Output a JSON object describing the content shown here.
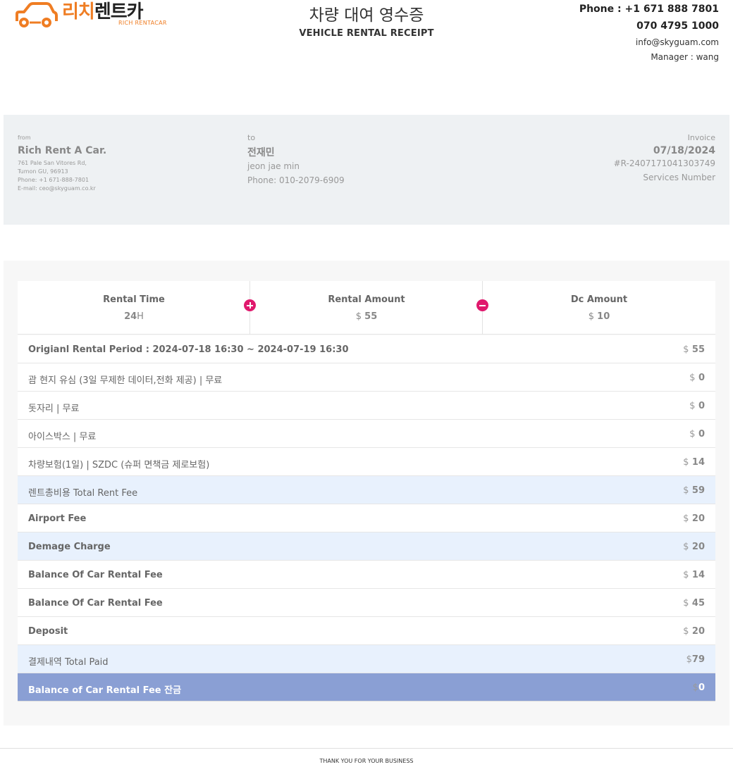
{
  "brand": {
    "name_ko_accent": "리치",
    "name_ko_rest": "렌트카",
    "name_en": "RICH RENTACAR",
    "accent_color": "#ef7d23"
  },
  "header": {
    "title": "차량 대여 영수증",
    "subtitle": "VEHICLE RENTAL RECEIPT"
  },
  "contact": {
    "phone1": "Phone : +1 671 888 7801",
    "phone2": "070 4795 1000",
    "email": "info@skyguam.com",
    "manager": "Manager : wang"
  },
  "from": {
    "label": "from",
    "name": "Rich Rent A Car.",
    "address1": "761 Pale San Vitores Rd,",
    "address2": "Tumon GU, 96913",
    "phone": "Phone: +1 671-888-7801",
    "email": "E-mail: ceo@skyguam.co.kr"
  },
  "to": {
    "label": "to",
    "name_ko": "전재민",
    "name_en": "jeon jae min",
    "phone": "Phone: 010-2079-6909"
  },
  "invoice": {
    "label": "Invoice",
    "date": "07/18/2024",
    "number": "#R-2407171041303749",
    "services": "Services Number"
  },
  "summary": {
    "rental_time": {
      "title": "Rental Time",
      "value": "24",
      "unit": "H"
    },
    "rental_amount": {
      "title": "Rental Amount",
      "currency": "$",
      "value": "55"
    },
    "dc_amount": {
      "title": "Dc Amount",
      "currency": "$",
      "value": "10"
    }
  },
  "rows": [
    {
      "label": "Origianl Rental Period : 2024-07-18 16:30 ~ 2024-07-19 16:30",
      "currency": "$",
      "amount": "55",
      "style": "plain",
      "bold": true
    },
    {
      "label": "괌 현지 유심 (3일 무제한 데이터,전화 제공) | 무료",
      "currency": "$",
      "amount": "0",
      "style": "plain",
      "bold": false
    },
    {
      "label": "돗자리 | 무료",
      "currency": "$",
      "amount": "0",
      "style": "plain",
      "bold": false
    },
    {
      "label": "아이스박스 | 무료",
      "currency": "$",
      "amount": "0",
      "style": "plain",
      "bold": false
    },
    {
      "label": "차량보험(1일) | SZDC (슈퍼 면책금 제로보험)",
      "currency": "$",
      "amount": "14",
      "style": "plain",
      "bold": false
    },
    {
      "label": "렌트총비용 Total Rent Fee",
      "currency": "$",
      "amount": "59",
      "style": "tint",
      "bold": false
    },
    {
      "label": "Airport Fee",
      "currency": "$",
      "amount": "20",
      "style": "plain",
      "bold": true
    },
    {
      "label": "Demage Charge",
      "currency": "$",
      "amount": "20",
      "style": "tint",
      "bold": true
    },
    {
      "label": "Balance Of Car Rental Fee",
      "currency": "$",
      "amount": "14",
      "style": "plain",
      "bold": true
    },
    {
      "label": "Balance Of Car Rental Fee",
      "currency": "$",
      "amount": "45",
      "style": "plain",
      "bold": true
    },
    {
      "label": "Deposit",
      "currency": "$",
      "amount": "20",
      "style": "plain",
      "bold": true
    },
    {
      "label": "결제내역 Total Paid",
      "currency": "$",
      "amount": "79",
      "style": "tint",
      "bold": false
    },
    {
      "label": "Balance of Car Rental Fee 잔금",
      "currency": "$",
      "amount": "0",
      "style": "dark",
      "bold": true
    }
  ],
  "footer": {
    "text": "THANK YOU FOR YOUR BUSINESS"
  }
}
